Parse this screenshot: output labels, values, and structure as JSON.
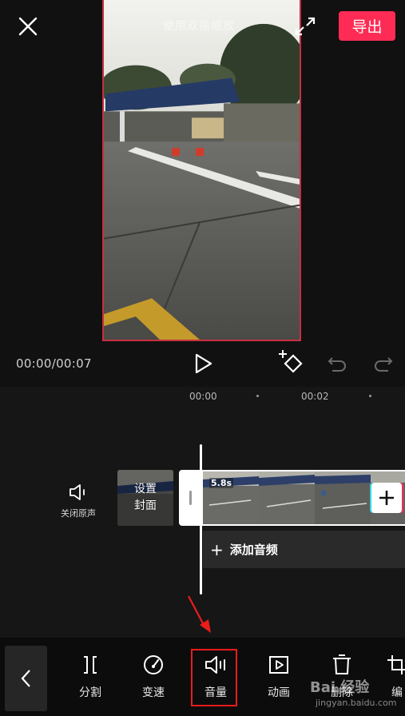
{
  "header": {
    "export_label": "导出",
    "watermark_text": "使用双指缩放"
  },
  "player": {
    "time_display": "00:00/00:07"
  },
  "timeline": {
    "ruler": [
      {
        "label": "00:00"
      },
      {
        "label": "00:02"
      }
    ],
    "mute_label": "关闭原声",
    "cover_label_line1": "设置",
    "cover_label_line2": "封面",
    "clip_duration": "5.8s",
    "add_audio_label": "添加音频"
  },
  "toolbar": {
    "items": [
      {
        "label": "分割",
        "icon": "split-icon"
      },
      {
        "label": "变速",
        "icon": "speed-icon"
      },
      {
        "label": "音量",
        "icon": "volume-icon"
      },
      {
        "label": "动画",
        "icon": "animation-icon"
      },
      {
        "label": "删除",
        "icon": "delete-icon"
      },
      {
        "label": "编",
        "icon": "edit-icon"
      }
    ]
  },
  "overlay": {
    "site_name": "Bai 经验",
    "site_url": "jingyan.baidu.com"
  },
  "colors": {
    "accent": "#fe2c55",
    "highlight": "#ea1c1c",
    "background": "#111111"
  }
}
